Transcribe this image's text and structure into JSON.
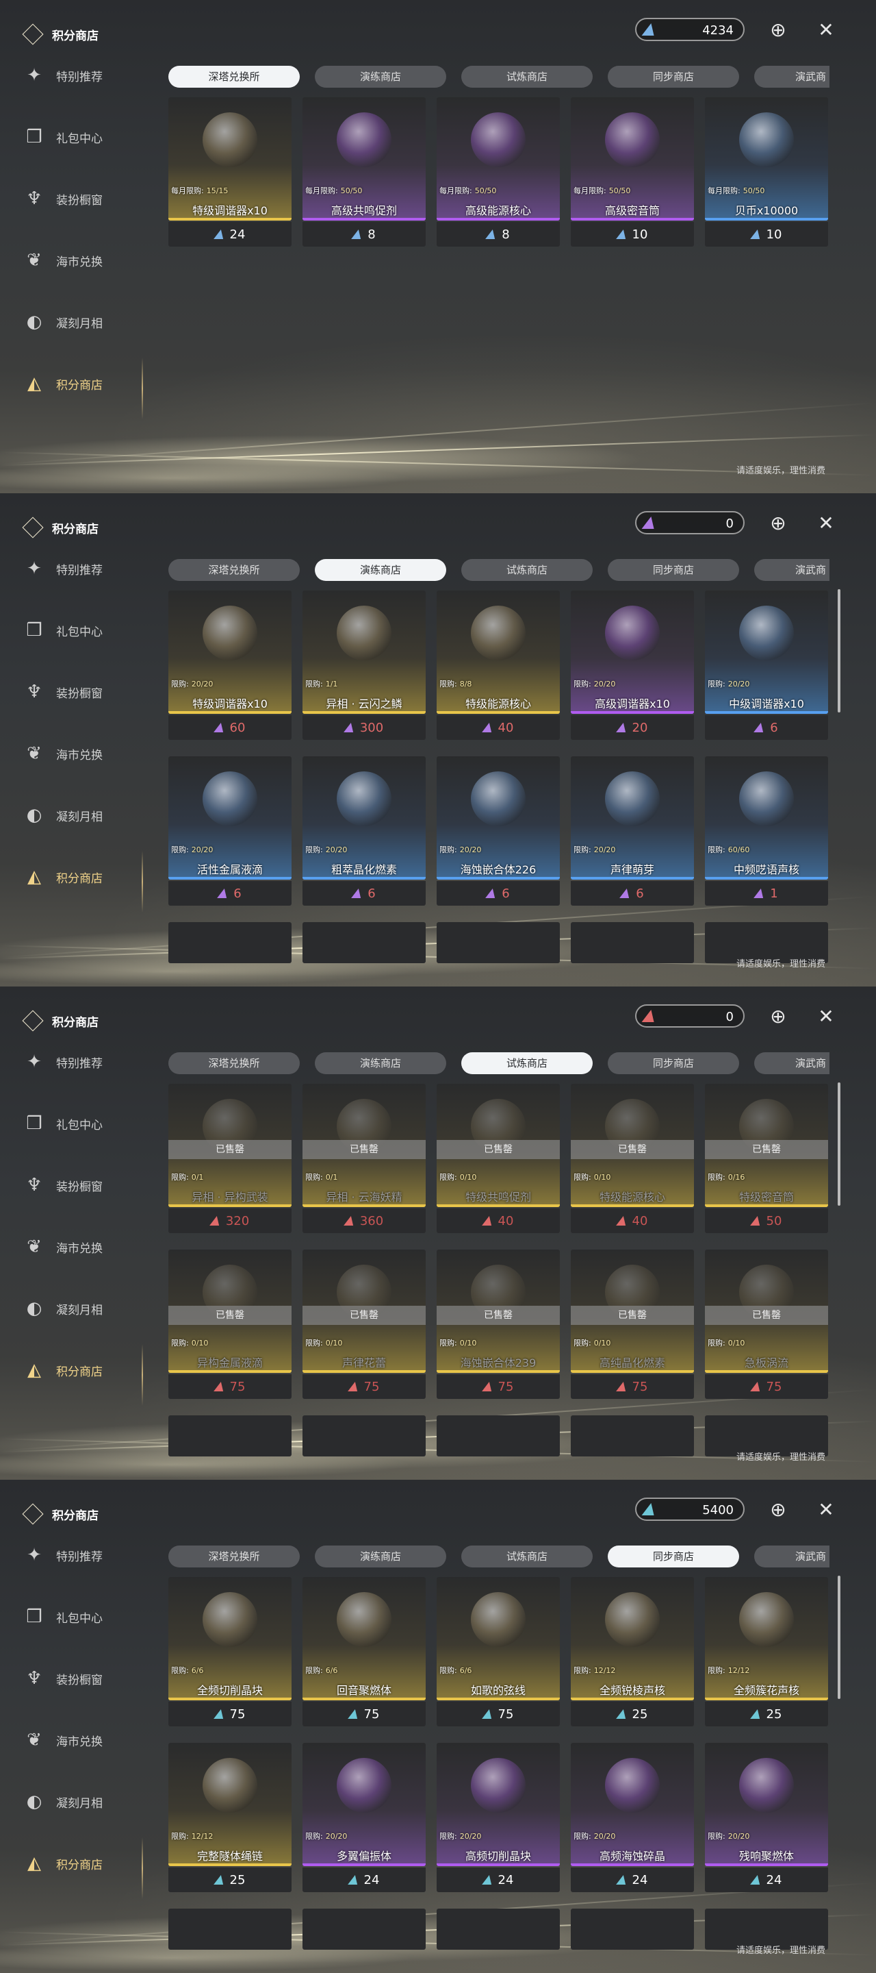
{
  "sidebar": {
    "brand": "积分商店",
    "items": [
      {
        "label": "特别推荐",
        "icon": "star-icon"
      },
      {
        "label": "礼包中心",
        "icon": "gift-icon"
      },
      {
        "label": "装扮橱窗",
        "icon": "shirt-icon"
      },
      {
        "label": "海市兑换",
        "icon": "coral-icon"
      },
      {
        "label": "凝刻月相",
        "icon": "moon-icon"
      },
      {
        "label": "积分商店",
        "icon": "points-shop-icon",
        "active": true
      }
    ]
  },
  "tabs": [
    "深塔兑换所",
    "演练商店",
    "试炼商店",
    "同步商店",
    "演武商"
  ],
  "footer": "请适度娱乐，理性消费",
  "sold_out_label": "已售罄",
  "panels": [
    {
      "active_tab": 0,
      "currency_value": "4234",
      "currency_color": "#7cb3e6",
      "rows": [
        [
          {
            "limit_label": "每月限购:",
            "limit": "15/15",
            "name": "特级调谐器x10",
            "price": "24",
            "rarity": "gold"
          },
          {
            "limit_label": "每月限购:",
            "limit": "50/50",
            "name": "高级共鸣促剂",
            "price": "8",
            "rarity": "purple"
          },
          {
            "limit_label": "每月限购:",
            "limit": "50/50",
            "name": "高级能源核心",
            "price": "8",
            "rarity": "purple"
          },
          {
            "limit_label": "每月限购:",
            "limit": "50/50",
            "name": "高级密音筒",
            "price": "10",
            "rarity": "purple"
          },
          {
            "limit_label": "每月限购:",
            "limit": "50/50",
            "name": "贝币x10000",
            "price": "10",
            "rarity": "blue"
          }
        ]
      ]
    },
    {
      "active_tab": 1,
      "currency_value": "0",
      "currency_color": "#b07ae6",
      "rows": [
        [
          {
            "limit_label": "限购:",
            "limit": "20/20",
            "name": "特级调谐器x10",
            "price": "60",
            "rarity": "gold"
          },
          {
            "limit_label": "限购:",
            "limit": "1/1",
            "name": "异相 · 云闪之鳞",
            "price": "300",
            "rarity": "gold"
          },
          {
            "limit_label": "限购:",
            "limit": "8/8",
            "name": "特级能源核心",
            "price": "40",
            "rarity": "gold"
          },
          {
            "limit_label": "限购:",
            "limit": "20/20",
            "name": "高级调谐器x10",
            "price": "20",
            "rarity": "purple"
          },
          {
            "limit_label": "限购:",
            "limit": "20/20",
            "name": "中级调谐器x10",
            "price": "6",
            "rarity": "blue"
          }
        ],
        [
          {
            "limit_label": "限购:",
            "limit": "20/20",
            "name": "活性金属液滴",
            "price": "6",
            "rarity": "blue"
          },
          {
            "limit_label": "限购:",
            "limit": "20/20",
            "name": "粗萃晶化燃素",
            "price": "6",
            "rarity": "blue"
          },
          {
            "limit_label": "限购:",
            "limit": "20/20",
            "name": "海蚀嵌合体226",
            "price": "6",
            "rarity": "blue"
          },
          {
            "limit_label": "限购:",
            "limit": "20/20",
            "name": "声律萌芽",
            "price": "6",
            "rarity": "blue"
          },
          {
            "limit_label": "限购:",
            "limit": "60/60",
            "name": "中频呓语声核",
            "price": "1",
            "rarity": "blue"
          }
        ]
      ]
    },
    {
      "active_tab": 2,
      "currency_value": "0",
      "currency_color": "#e06a6a",
      "rows": [
        [
          {
            "limit_label": "限购:",
            "limit": "0/1",
            "name": "异相 · 异构武装",
            "price": "320",
            "rarity": "gold",
            "sold": true
          },
          {
            "limit_label": "限购:",
            "limit": "0/1",
            "name": "异相 · 云海妖精",
            "price": "360",
            "rarity": "gold",
            "sold": true
          },
          {
            "limit_label": "限购:",
            "limit": "0/10",
            "name": "特级共鸣促剂",
            "price": "40",
            "rarity": "gold",
            "sold": true
          },
          {
            "limit_label": "限购:",
            "limit": "0/10",
            "name": "特级能源核心",
            "price": "40",
            "rarity": "gold",
            "sold": true
          },
          {
            "limit_label": "限购:",
            "limit": "0/16",
            "name": "特级密音筒",
            "price": "50",
            "rarity": "gold",
            "sold": true
          }
        ],
        [
          {
            "limit_label": "限购:",
            "limit": "0/10",
            "name": "异构金属液滴",
            "price": "75",
            "rarity": "gold",
            "sold": true
          },
          {
            "limit_label": "限购:",
            "limit": "0/10",
            "name": "声律花蕾",
            "price": "75",
            "rarity": "gold",
            "sold": true
          },
          {
            "limit_label": "限购:",
            "limit": "0/10",
            "name": "海蚀嵌合体239",
            "price": "75",
            "rarity": "gold",
            "sold": true
          },
          {
            "limit_label": "限购:",
            "limit": "0/10",
            "name": "高纯晶化燃素",
            "price": "75",
            "rarity": "gold",
            "sold": true
          },
          {
            "limit_label": "限购:",
            "limit": "0/10",
            "name": "急板涡流",
            "price": "75",
            "rarity": "gold",
            "sold": true
          }
        ]
      ]
    },
    {
      "active_tab": 3,
      "currency_value": "5400",
      "currency_color": "#6ec6d6",
      "rows": [
        [
          {
            "limit_label": "限购:",
            "limit": "6/6",
            "name": "全频切削晶块",
            "price": "75",
            "rarity": "gold"
          },
          {
            "limit_label": "限购:",
            "limit": "6/6",
            "name": "回音聚燃体",
            "price": "75",
            "rarity": "gold"
          },
          {
            "limit_label": "限购:",
            "limit": "6/6",
            "name": "如歌的弦线",
            "price": "75",
            "rarity": "gold"
          },
          {
            "limit_label": "限购:",
            "limit": "12/12",
            "name": "全频锐棱声核",
            "price": "25",
            "rarity": "gold"
          },
          {
            "limit_label": "限购:",
            "limit": "12/12",
            "name": "全频簇花声核",
            "price": "25",
            "rarity": "gold"
          }
        ],
        [
          {
            "limit_label": "限购:",
            "limit": "12/12",
            "name": "完整隧体绳链",
            "price": "25",
            "rarity": "gold"
          },
          {
            "limit_label": "限购:",
            "limit": "20/20",
            "name": "多翼偏振体",
            "price": "24",
            "rarity": "purple"
          },
          {
            "limit_label": "限购:",
            "limit": "20/20",
            "name": "高频切削晶块",
            "price": "24",
            "rarity": "purple"
          },
          {
            "limit_label": "限购:",
            "limit": "20/20",
            "name": "高频海蚀碎晶",
            "price": "24",
            "rarity": "purple"
          },
          {
            "limit_label": "限购:",
            "limit": "20/20",
            "name": "残响聚燃体",
            "price": "24",
            "rarity": "purple"
          }
        ]
      ]
    }
  ]
}
